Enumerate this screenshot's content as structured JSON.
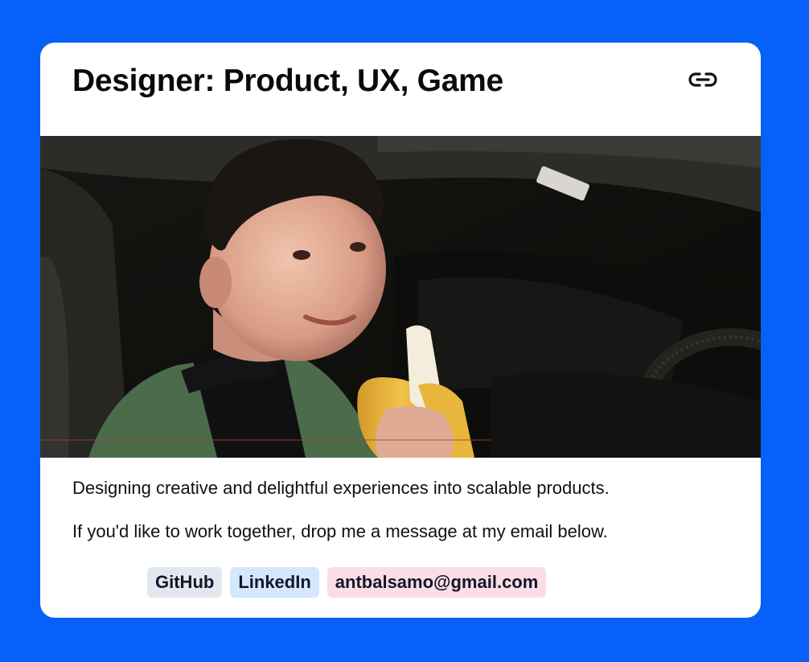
{
  "header": {
    "title": "Designer: Product, UX, Game",
    "link_icon": "link-icon"
  },
  "photo": {
    "alt": "Portrait of the designer holding a banana in a car"
  },
  "description": {
    "line1": "Designing creative and delightful experiences into scalable products.",
    "line2": "If you'd like to work together, drop me a message at my email below."
  },
  "links": {
    "github": "GitHub",
    "linkedin": "LinkedIn",
    "email": "antbalsamo@gmail.com"
  },
  "colors": {
    "background": "#0760f7",
    "card": "#ffffff",
    "github_tag": "#e3e8ef",
    "linkedin_tag": "#d4e7fb",
    "email_tag": "#fbdde6"
  }
}
